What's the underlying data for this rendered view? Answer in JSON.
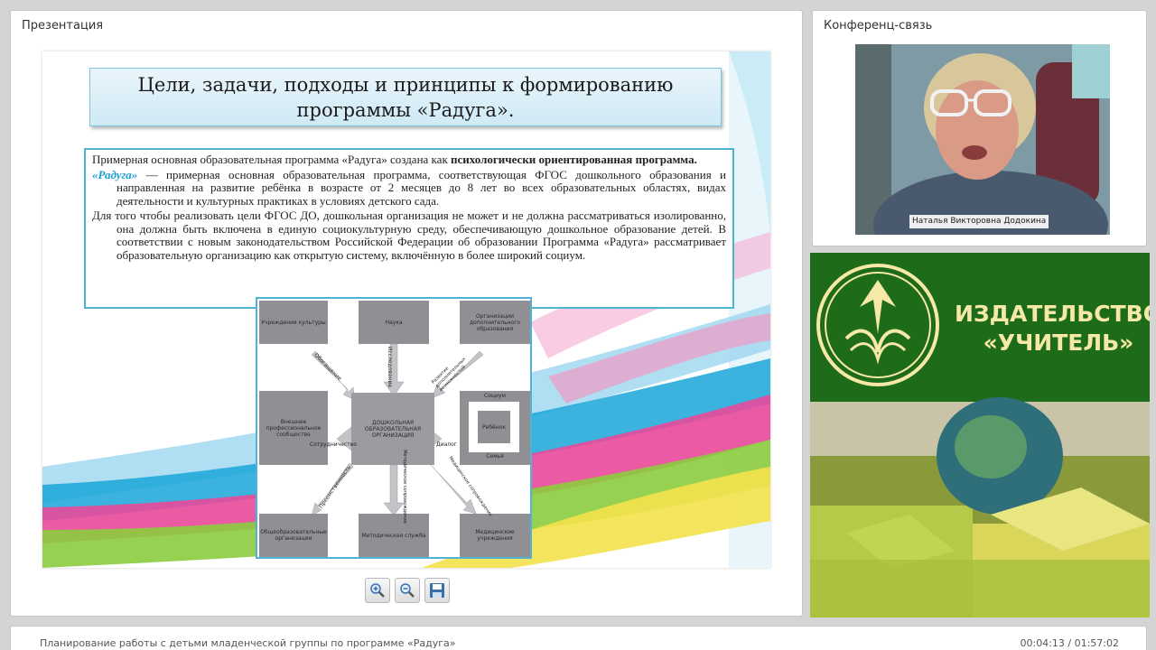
{
  "presentation": {
    "panel_title": "Презентация",
    "slide": {
      "title_line1": "Цели, задачи, подходы и принципы к формированию",
      "title_line2": "программы «Радуга».",
      "p1_text": "Примерная основная образовательная программа «Радуга» создана как ",
      "p1_bold": "психологически ориентированная программа.",
      "p2_name": "«Радуга»",
      "p2_text": " — примерная основная образовательная программа, соответствующая ФГОС дошкольного образования и направленная на развитие ребёнка в возрасте от 2 месяцев до 8 лет во всех образовательных областях, видах деятельности и культурных практиках в условиях детского сада.",
      "p3_text": "Для того чтобы реализовать цели ФГОС ДО, дошкольная организация не может и не должна рассматриваться изолированно, она должна быть включена в единую социокультурную среду, обеспечивающую дошкольное образование детей. В соответствии с новым законодательством Российской Федерации об образовании Программа «Радуга» рассматривает образовательную организацию как открытую систему, включённую в более широкий социум."
    },
    "diagram": {
      "center": "ДОШКОЛЬНАЯ ОБРАЗОВАТЕЛЬНАЯ ОРГАНИЗАЦИЯ",
      "top_left": "Учреждения культуры",
      "top": "Наука",
      "top_right": "Организации дополнительного образования",
      "left": "Внешнее профессиональное сообщество",
      "right_outer": "Социум",
      "right_inner": "Ребёнок",
      "right_family": "Семья",
      "bottom_left": "Общеобразовательные организации",
      "bottom": "Методическая служба",
      "bottom_right": "Медицинские учреждения",
      "arrow_obogashchenie": "Обогащение",
      "arrow_issledovanie": "Исследование",
      "arrow_razvitie": "Развитие дополнительных возможностей",
      "arrow_sotrudnichestvo": "Сотрудничество",
      "arrow_dialog": "Диалог",
      "arrow_preemstvennost": "Преемственность",
      "arrow_metod": "Методическое сопровождение",
      "arrow_med": "Медицинское сопровождение"
    },
    "toolbar": {
      "zoom_in": "zoom-in-icon",
      "zoom_out": "zoom-out-icon",
      "save": "save-icon"
    }
  },
  "conference": {
    "panel_title": "Конференц-связь",
    "speaker_name": "Наталья Викторовна Додокина"
  },
  "publisher": {
    "line1": "ИЗДАТЕЛЬСТВО",
    "line2": "«УЧИТЕЛЬ»"
  },
  "bottom_bar": {
    "lecture_title": "Планирование работы с детьми младенческой группы по программе «Радуга»",
    "time": "00:04:13 / 01:57:02"
  },
  "colors": {
    "accent_blue": "#4fb3d4",
    "publisher_green": "#1f6e1a",
    "publisher_gold": "#f6e9a8"
  }
}
